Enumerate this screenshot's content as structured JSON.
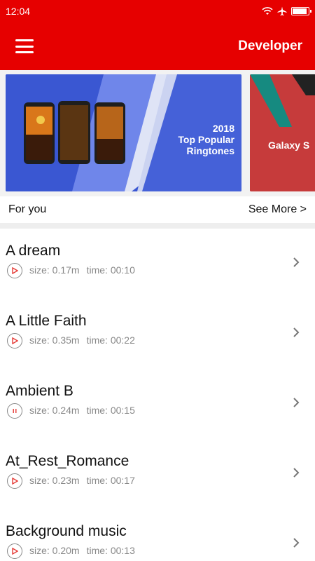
{
  "status_bar": {
    "time": "12:04"
  },
  "app_bar": {
    "title": "Developer"
  },
  "banners": [
    {
      "text_line1": "2018",
      "text_line2": "Top Popular",
      "text_line3": "Ringtones"
    },
    {
      "text": "Galaxy S"
    }
  ],
  "section": {
    "title": "For you",
    "see_more": "See More >"
  },
  "ringtones": [
    {
      "title": "A dream",
      "size": "size: 0.17m",
      "time": "time: 00:10",
      "state": "play"
    },
    {
      "title": "A Little Faith",
      "size": "size: 0.35m",
      "time": "time: 00:22",
      "state": "play"
    },
    {
      "title": "Ambient B",
      "size": "size: 0.24m",
      "time": "time: 00:15",
      "state": "pause"
    },
    {
      "title": "At_Rest_Romance",
      "size": "size: 0.23m",
      "time": "time: 00:17",
      "state": "play"
    },
    {
      "title": "Background music",
      "size": "size: 0.20m",
      "time": "time: 00:13",
      "state": "play"
    }
  ],
  "colors": {
    "brand": "#e60000",
    "accent_play": "#e53935"
  },
  "icons": {
    "menu": "hamburger-menu-icon",
    "wifi": "wifi-icon",
    "airplane": "airplane-icon",
    "battery": "battery-icon",
    "chevron": "chevron-right-icon"
  }
}
